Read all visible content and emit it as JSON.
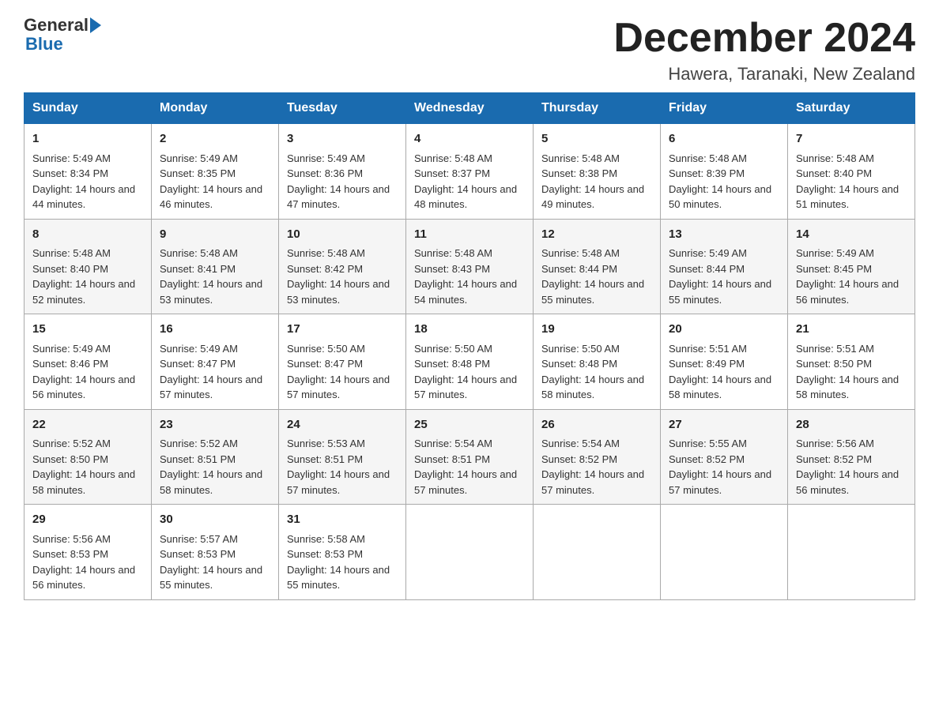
{
  "header": {
    "logo_text_general": "General",
    "logo_text_blue": "Blue",
    "month_title": "December 2024",
    "location": "Hawera, Taranaki, New Zealand"
  },
  "days_of_week": [
    "Sunday",
    "Monday",
    "Tuesday",
    "Wednesday",
    "Thursday",
    "Friday",
    "Saturday"
  ],
  "weeks": [
    [
      {
        "day": "1",
        "sunrise": "Sunrise: 5:49 AM",
        "sunset": "Sunset: 8:34 PM",
        "daylight": "Daylight: 14 hours and 44 minutes."
      },
      {
        "day": "2",
        "sunrise": "Sunrise: 5:49 AM",
        "sunset": "Sunset: 8:35 PM",
        "daylight": "Daylight: 14 hours and 46 minutes."
      },
      {
        "day": "3",
        "sunrise": "Sunrise: 5:49 AM",
        "sunset": "Sunset: 8:36 PM",
        "daylight": "Daylight: 14 hours and 47 minutes."
      },
      {
        "day": "4",
        "sunrise": "Sunrise: 5:48 AM",
        "sunset": "Sunset: 8:37 PM",
        "daylight": "Daylight: 14 hours and 48 minutes."
      },
      {
        "day": "5",
        "sunrise": "Sunrise: 5:48 AM",
        "sunset": "Sunset: 8:38 PM",
        "daylight": "Daylight: 14 hours and 49 minutes."
      },
      {
        "day": "6",
        "sunrise": "Sunrise: 5:48 AM",
        "sunset": "Sunset: 8:39 PM",
        "daylight": "Daylight: 14 hours and 50 minutes."
      },
      {
        "day": "7",
        "sunrise": "Sunrise: 5:48 AM",
        "sunset": "Sunset: 8:40 PM",
        "daylight": "Daylight: 14 hours and 51 minutes."
      }
    ],
    [
      {
        "day": "8",
        "sunrise": "Sunrise: 5:48 AM",
        "sunset": "Sunset: 8:40 PM",
        "daylight": "Daylight: 14 hours and 52 minutes."
      },
      {
        "day": "9",
        "sunrise": "Sunrise: 5:48 AM",
        "sunset": "Sunset: 8:41 PM",
        "daylight": "Daylight: 14 hours and 53 minutes."
      },
      {
        "day": "10",
        "sunrise": "Sunrise: 5:48 AM",
        "sunset": "Sunset: 8:42 PM",
        "daylight": "Daylight: 14 hours and 53 minutes."
      },
      {
        "day": "11",
        "sunrise": "Sunrise: 5:48 AM",
        "sunset": "Sunset: 8:43 PM",
        "daylight": "Daylight: 14 hours and 54 minutes."
      },
      {
        "day": "12",
        "sunrise": "Sunrise: 5:48 AM",
        "sunset": "Sunset: 8:44 PM",
        "daylight": "Daylight: 14 hours and 55 minutes."
      },
      {
        "day": "13",
        "sunrise": "Sunrise: 5:49 AM",
        "sunset": "Sunset: 8:44 PM",
        "daylight": "Daylight: 14 hours and 55 minutes."
      },
      {
        "day": "14",
        "sunrise": "Sunrise: 5:49 AM",
        "sunset": "Sunset: 8:45 PM",
        "daylight": "Daylight: 14 hours and 56 minutes."
      }
    ],
    [
      {
        "day": "15",
        "sunrise": "Sunrise: 5:49 AM",
        "sunset": "Sunset: 8:46 PM",
        "daylight": "Daylight: 14 hours and 56 minutes."
      },
      {
        "day": "16",
        "sunrise": "Sunrise: 5:49 AM",
        "sunset": "Sunset: 8:47 PM",
        "daylight": "Daylight: 14 hours and 57 minutes."
      },
      {
        "day": "17",
        "sunrise": "Sunrise: 5:50 AM",
        "sunset": "Sunset: 8:47 PM",
        "daylight": "Daylight: 14 hours and 57 minutes."
      },
      {
        "day": "18",
        "sunrise": "Sunrise: 5:50 AM",
        "sunset": "Sunset: 8:48 PM",
        "daylight": "Daylight: 14 hours and 57 minutes."
      },
      {
        "day": "19",
        "sunrise": "Sunrise: 5:50 AM",
        "sunset": "Sunset: 8:48 PM",
        "daylight": "Daylight: 14 hours and 58 minutes."
      },
      {
        "day": "20",
        "sunrise": "Sunrise: 5:51 AM",
        "sunset": "Sunset: 8:49 PM",
        "daylight": "Daylight: 14 hours and 58 minutes."
      },
      {
        "day": "21",
        "sunrise": "Sunrise: 5:51 AM",
        "sunset": "Sunset: 8:50 PM",
        "daylight": "Daylight: 14 hours and 58 minutes."
      }
    ],
    [
      {
        "day": "22",
        "sunrise": "Sunrise: 5:52 AM",
        "sunset": "Sunset: 8:50 PM",
        "daylight": "Daylight: 14 hours and 58 minutes."
      },
      {
        "day": "23",
        "sunrise": "Sunrise: 5:52 AM",
        "sunset": "Sunset: 8:51 PM",
        "daylight": "Daylight: 14 hours and 58 minutes."
      },
      {
        "day": "24",
        "sunrise": "Sunrise: 5:53 AM",
        "sunset": "Sunset: 8:51 PM",
        "daylight": "Daylight: 14 hours and 57 minutes."
      },
      {
        "day": "25",
        "sunrise": "Sunrise: 5:54 AM",
        "sunset": "Sunset: 8:51 PM",
        "daylight": "Daylight: 14 hours and 57 minutes."
      },
      {
        "day": "26",
        "sunrise": "Sunrise: 5:54 AM",
        "sunset": "Sunset: 8:52 PM",
        "daylight": "Daylight: 14 hours and 57 minutes."
      },
      {
        "day": "27",
        "sunrise": "Sunrise: 5:55 AM",
        "sunset": "Sunset: 8:52 PM",
        "daylight": "Daylight: 14 hours and 57 minutes."
      },
      {
        "day": "28",
        "sunrise": "Sunrise: 5:56 AM",
        "sunset": "Sunset: 8:52 PM",
        "daylight": "Daylight: 14 hours and 56 minutes."
      }
    ],
    [
      {
        "day": "29",
        "sunrise": "Sunrise: 5:56 AM",
        "sunset": "Sunset: 8:53 PM",
        "daylight": "Daylight: 14 hours and 56 minutes."
      },
      {
        "day": "30",
        "sunrise": "Sunrise: 5:57 AM",
        "sunset": "Sunset: 8:53 PM",
        "daylight": "Daylight: 14 hours and 55 minutes."
      },
      {
        "day": "31",
        "sunrise": "Sunrise: 5:58 AM",
        "sunset": "Sunset: 8:53 PM",
        "daylight": "Daylight: 14 hours and 55 minutes."
      },
      null,
      null,
      null,
      null
    ]
  ]
}
